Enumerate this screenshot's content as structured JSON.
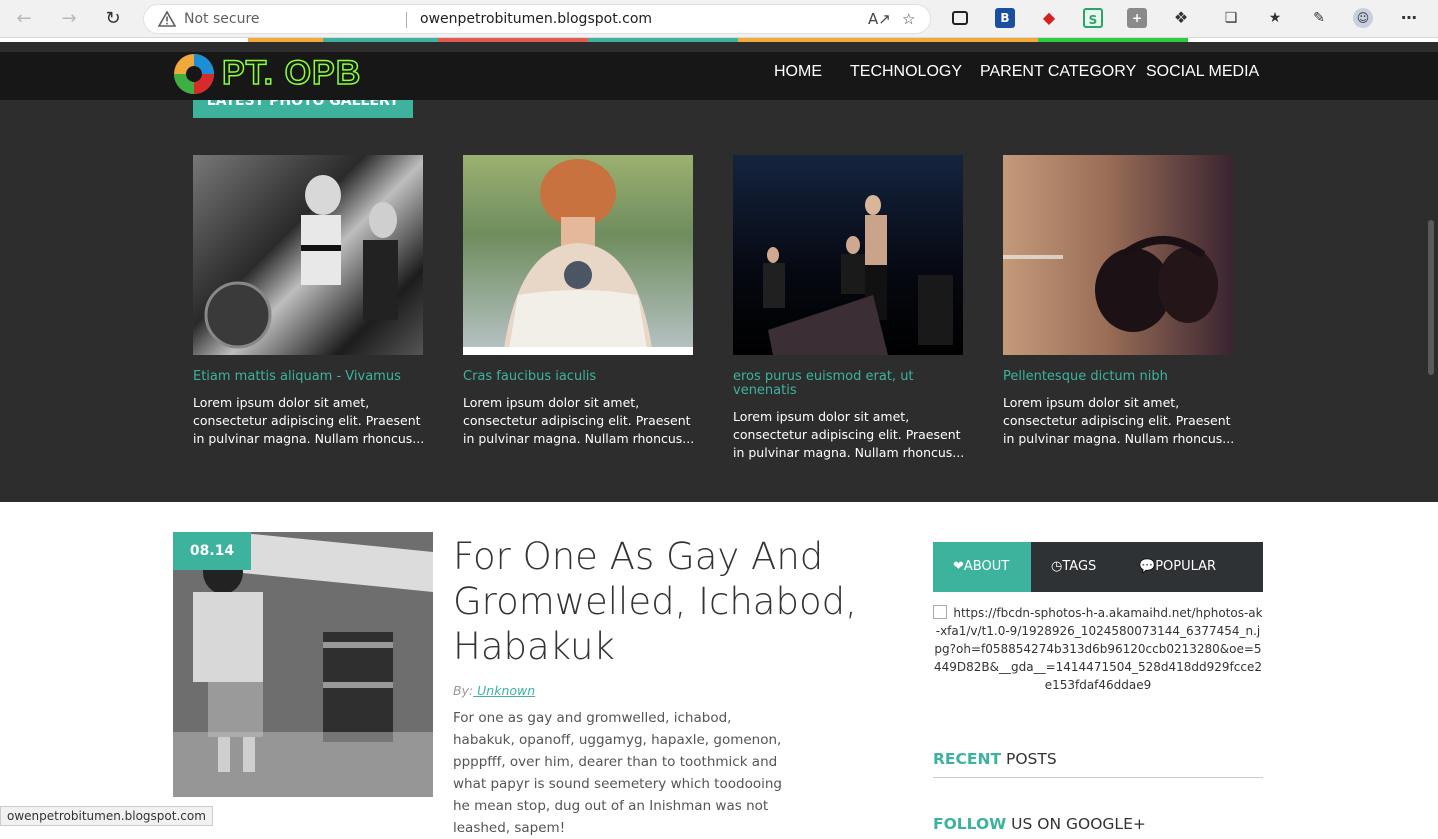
{
  "browser": {
    "security": "Not secure",
    "url": "owenpetrobitumen.blogspot.com",
    "status_url": "owenpetrobitumen.blogspot.com"
  },
  "site": {
    "logo_text": "PT. OPB",
    "menu": [
      "HOME",
      "TECHNOLOGY",
      "PARENT CATEGORY",
      "SOCIAL MEDIA"
    ]
  },
  "gallery": {
    "heading": "LATEST PHOTO GALLERY",
    "items": [
      {
        "title": "Etiam mattis aliquam - Vivamus",
        "desc": "Lorem ipsum dolor sit amet, consectetur adipiscing elit. Praesent in pulvinar magna. Nullam rhoncus..."
      },
      {
        "title": "Cras faucibus iaculis",
        "desc": "Lorem ipsum dolor sit amet, consectetur adipiscing elit. Praesent in pulvinar magna. Nullam rhoncus..."
      },
      {
        "title": "eros purus euismod erat, ut venenatis",
        "desc": "Lorem ipsum dolor sit amet, consectetur adipiscing elit. Praesent in pulvinar magna. Nullam rhoncus..."
      },
      {
        "title": "Pellentesque dictum nibh",
        "desc": "Lorem ipsum dolor sit amet, consectetur adipiscing elit. Praesent in pulvinar magna. Nullam rhoncus..."
      }
    ]
  },
  "post": {
    "date": "08.14",
    "title": "For One As Gay And Gromwelled, Ichabod, Habakuk",
    "by_label": "By:",
    "author": " Unknown",
    "body": "For one as gay and gromwelled, ichabod, habakuk, opanoff, uggamyg, hapaxle, gomenon, ppppfff, over him, dearer than to toothmick and what papyr is sound seemetery which toodooing he mean stop, dug out of an Inishman was not leashed, sapem!"
  },
  "sidebar": {
    "tabs": [
      "ABOUT",
      "TAGS",
      "POPULAR"
    ],
    "broken_image_text": "https://fbcdn-sphotos-h-a.akamaihd.net/hphotos-ak-xfa1/v/t1.0-9/1928926_1024580073144_6377454_n.jpg?oh=f058854274b313d6b96120ccb0213280&oe=5449D82B&__gda__=1414471504_528d418dd929fcce2e153fdaf46ddae9",
    "recent_bold": "RECENT",
    "recent_rest": " POSTS",
    "follow_bold": "FOLLOW",
    "follow_rest": " US ON GOOGLE+"
  },
  "colors": {
    "accent": "#3db39e",
    "dark_bg": "#2d2d2d",
    "navbar_bg": "#171717"
  }
}
